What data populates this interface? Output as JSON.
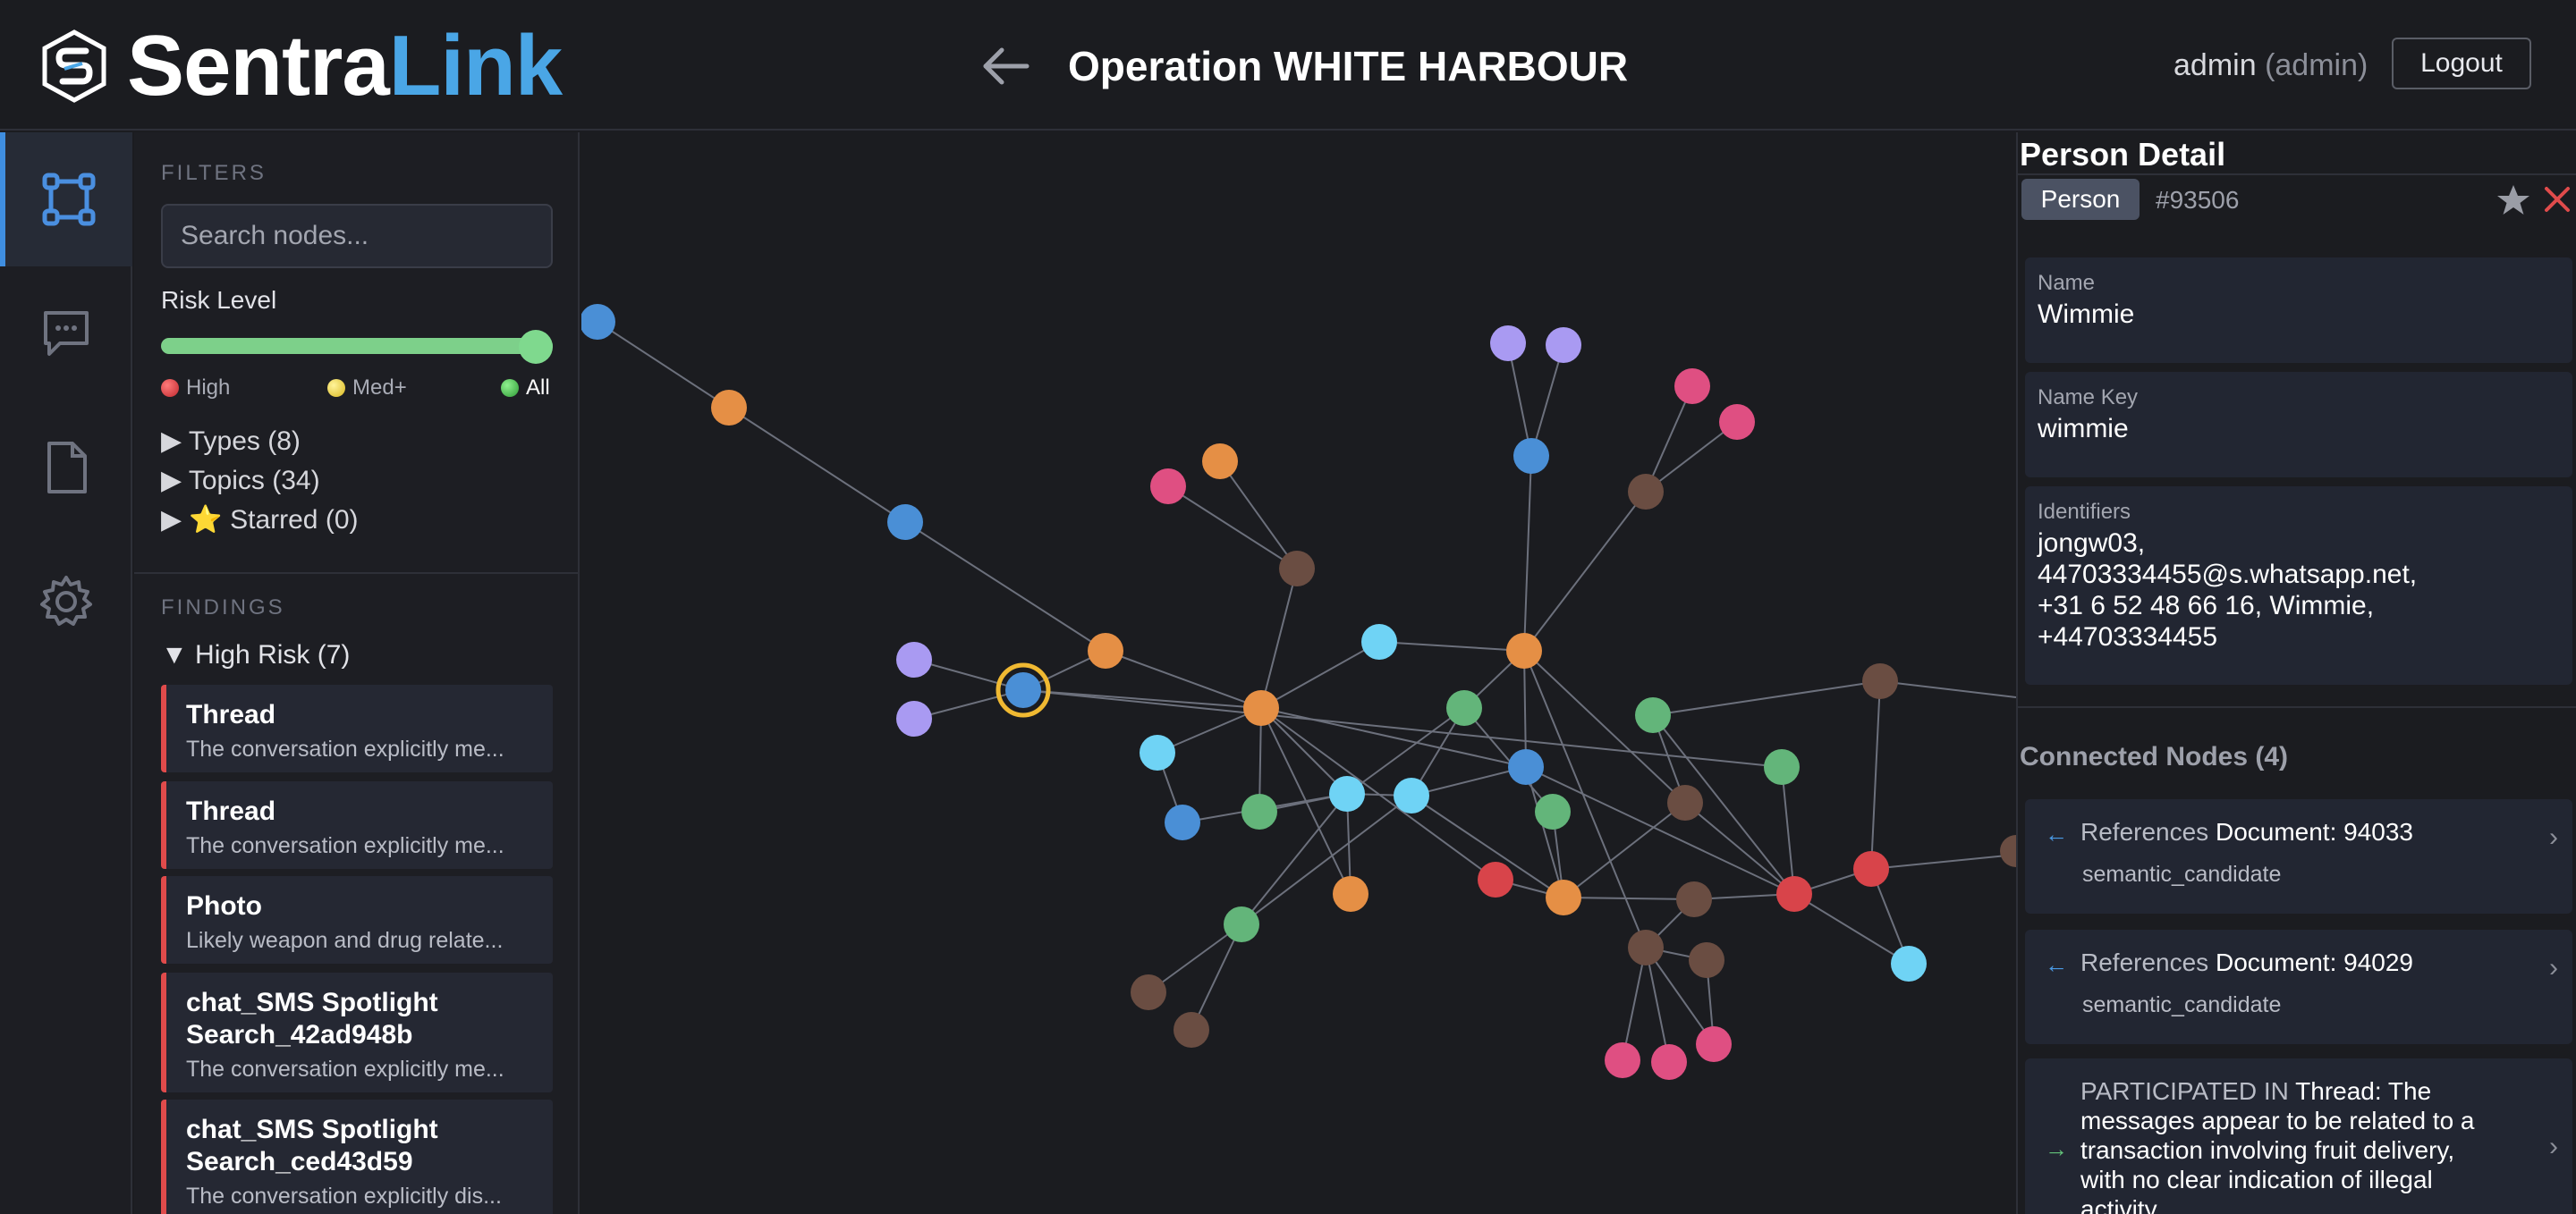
{
  "app": {
    "brand_first": "Sentra",
    "brand_second": "Link",
    "title": "Operation WHITE HARBOUR",
    "user": "admin",
    "role": "(admin)",
    "logout_label": "Logout"
  },
  "rail": {
    "items": [
      "graph-icon",
      "chat-icon",
      "document-icon",
      "settings-icon"
    ],
    "active": "graph-icon"
  },
  "filters": {
    "heading": "FILTERS",
    "search_placeholder": "Search nodes...",
    "risk_label": "Risk Level",
    "risk_selected": "All",
    "legend": [
      {
        "label": "High",
        "color": "#e04b4b"
      },
      {
        "label": "Med+",
        "color": "#f0d64a"
      },
      {
        "label": "All",
        "color": "#3fbf4a"
      }
    ],
    "tree": [
      {
        "arrow": "▶",
        "label": "Types (8)"
      },
      {
        "arrow": "▶",
        "label": "Topics (34)"
      },
      {
        "arrow": "▶",
        "label": "⭐ Starred (0)"
      }
    ]
  },
  "findings": {
    "heading": "FINDINGS",
    "group_arrow": "▼",
    "group_label": "High Risk (7)",
    "items": [
      {
        "title": "Thread",
        "desc": "The conversation explicitly me..."
      },
      {
        "title": "Thread",
        "desc": "The conversation explicitly me..."
      },
      {
        "title": "Photo",
        "desc": "Likely weapon and drug relate..."
      },
      {
        "title_line1": "chat_SMS Spotlight",
        "title_line2": "Search_42ad948b",
        "desc": "The conversation explicitly me..."
      },
      {
        "title_line1": "chat_SMS Spotlight",
        "title_line2": "Search_ced43d59",
        "desc": "The conversation explicitly dis..."
      }
    ]
  },
  "detail": {
    "heading": "Person Detail",
    "type": "Person",
    "id": "#93506",
    "fields": [
      {
        "label": "Name",
        "value": "Wimmie"
      },
      {
        "label": "Name Key",
        "value": "wimmie"
      },
      {
        "label": "Identifiers",
        "value_lines": [
          "jongw03,",
          "44703334455@s.whatsapp.net,",
          "+31 6 52 48 66 16, Wimmie,",
          "+44703334455"
        ]
      }
    ],
    "connected_title": "Connected Nodes (4)",
    "connections": [
      {
        "arrow": "←",
        "relation": "References",
        "target": "Document: 94033",
        "sub": "semantic_candidate"
      },
      {
        "arrow": "←",
        "relation": "References",
        "target": "Document: 94029",
        "sub": "semantic_candidate"
      },
      {
        "arrow": "→",
        "relation": "PARTICIPATED IN",
        "target_lines": [
          "Thread: The",
          "messages appear to be related to a",
          "transaction involving fruit delivery,",
          "with no clear indication of illegal",
          "activity"
        ]
      }
    ]
  },
  "graph": {
    "palette": {
      "blue": "#4a8fd6",
      "orange": "#e58f45",
      "purple": "#a99af2",
      "cyan": "#6fd3f5",
      "green": "#63b57a",
      "brown": "#6a4d42",
      "pink": "#df4f82",
      "red": "#d8444a",
      "selected_ring": "#f0b932",
      "edge": "#6c707c"
    }
  }
}
